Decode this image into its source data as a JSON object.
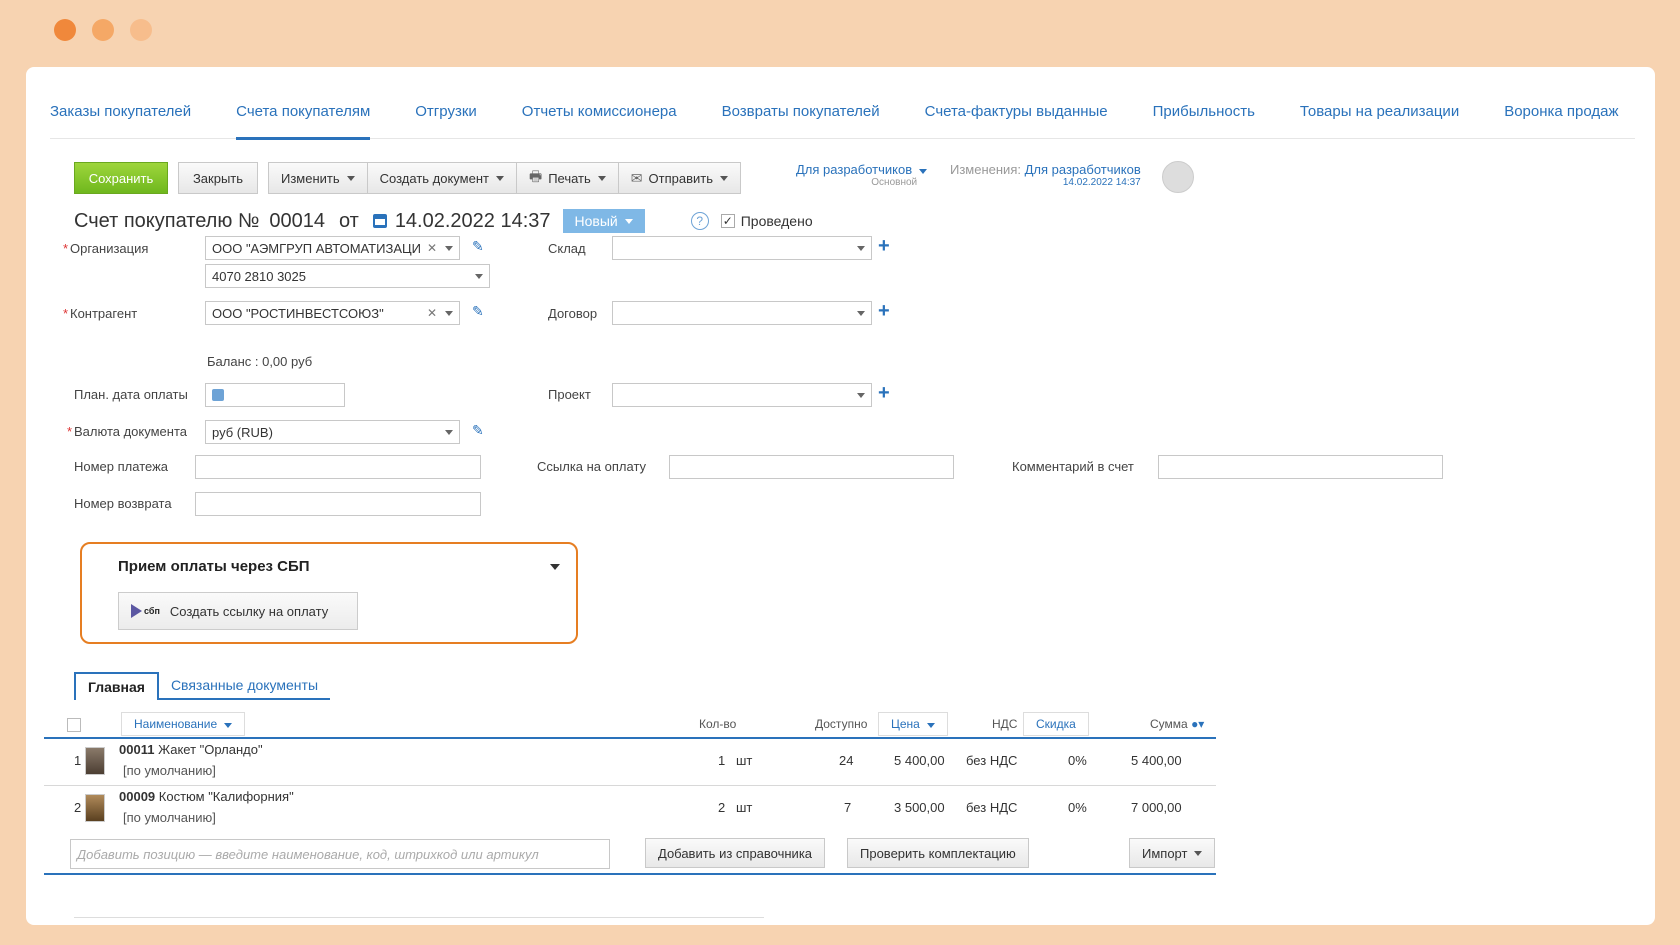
{
  "window": {
    "dot_colors": [
      "#f0883b",
      "#f5a866",
      "#f7bd8c"
    ]
  },
  "tabs": [
    {
      "label": "Заказы покупателей"
    },
    {
      "label": "Счета покупателям"
    },
    {
      "label": "Отгрузки"
    },
    {
      "label": "Отчеты комиссионера"
    },
    {
      "label": "Возвраты покупателей"
    },
    {
      "label": "Счета-фактуры выданные"
    },
    {
      "label": "Прибыльность"
    },
    {
      "label": "Товары на реализации"
    },
    {
      "label": "Воронка продаж"
    }
  ],
  "toolbar": {
    "save": "Сохранить",
    "close": "Закрыть",
    "edit": "Изменить",
    "create_doc": "Создать документ",
    "print": "Печать",
    "send": "Отправить",
    "dev": "Для разработчиков",
    "dev_sub": "Основной",
    "changes_label": "Изменения:",
    "changes_who": "Для разработчиков",
    "changes_time": "14.02.2022 14:37"
  },
  "doc": {
    "title": "Счет покупателю №",
    "number": "00014",
    "from": "от",
    "datetime": "14.02.2022 14:37",
    "status": "Новый",
    "help": "?",
    "posted_check": "✓",
    "posted": "Проведено"
  },
  "form": {
    "org_label": "Организация",
    "org_value": "ООО \"АЭМГРУП АВТОМАТИЗАЦИ",
    "account_value": "4070 2810 3025",
    "counterparty_label": "Контрагент",
    "counterparty_value": "ООО \"РОСТИНВЕСТСОЮЗ\"",
    "balance": "Баланс : 0,00 руб",
    "plan_date_label": "План. дата оплаты",
    "currency_label": "Валюта документа",
    "currency_value": "руб (RUB)",
    "payment_no_label": "Номер платежа",
    "return_no_label": "Номер возврата",
    "warehouse_label": "Склад",
    "contract_label": "Договор",
    "project_label": "Проект",
    "pay_link_label": "Ссылка на оплату",
    "comment_label": "Комментарий в счет"
  },
  "sbp": {
    "title": "Прием оплаты через СБП",
    "logo": "сбп",
    "button": "Создать ссылку на оплату"
  },
  "inner_tabs": [
    {
      "label": "Главная"
    },
    {
      "label": "Связанные документы"
    }
  ],
  "table": {
    "headers": {
      "name": "Наименование",
      "qty": "Кол-во",
      "available": "Доступно",
      "price": "Цена",
      "vat": "НДС",
      "discount": "Скидка",
      "sum": "Сумма"
    },
    "rows": [
      {
        "idx": "1",
        "code": "00011",
        "name": "Жакет \"Орландо\"",
        "variant": "[по умолчанию]",
        "qty": "1",
        "unit": "шт",
        "available": "24",
        "price": "5 400,00",
        "vat": "без НДС",
        "discount": "0%",
        "sum": "5 400,00"
      },
      {
        "idx": "2",
        "code": "00009",
        "name": "Костюм \"Калифорния\"",
        "variant": "[по умолчанию]",
        "qty": "2",
        "unit": "шт",
        "available": "7",
        "price": "3 500,00",
        "vat": "без НДС",
        "discount": "0%",
        "sum": "7 000,00"
      }
    ],
    "add_placeholder": "Добавить позицию — введите наименование, код, штрихкод или артикул",
    "add_from_catalog": "Добавить из справочника",
    "check_kit": "Проверить комплектацию",
    "import": "Импорт"
  }
}
